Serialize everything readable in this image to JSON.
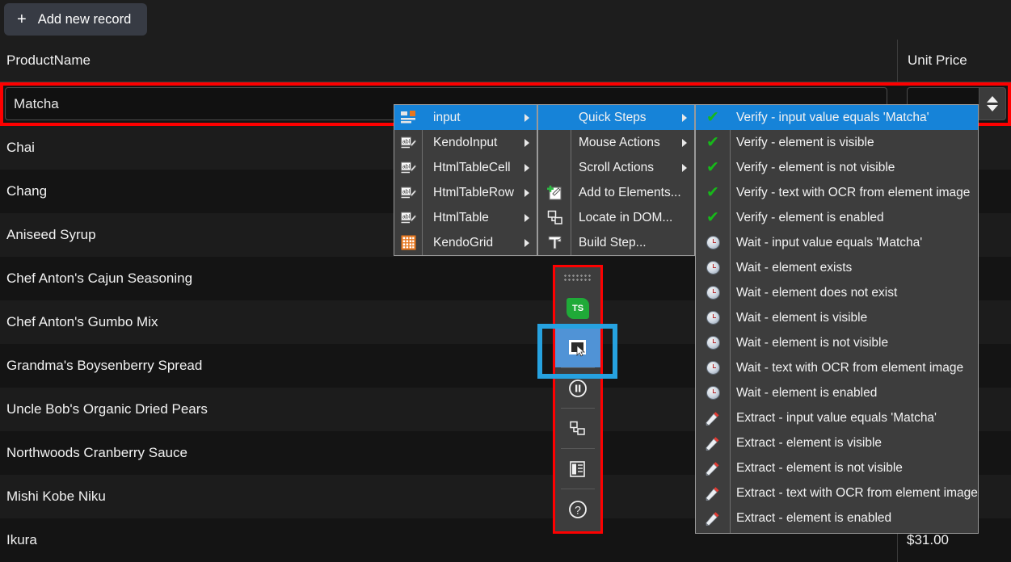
{
  "toolbar": {
    "add_record_label": "Add new record",
    "plus_glyph": "+"
  },
  "grid": {
    "columns": [
      "ProductName",
      "Unit Price"
    ],
    "edit_row": {
      "product_name_value": "Matcha",
      "unit_price_value": ""
    },
    "rows": [
      {
        "name": "Chai",
        "price": ""
      },
      {
        "name": "Chang",
        "price": ""
      },
      {
        "name": "Aniseed Syrup",
        "price": ""
      },
      {
        "name": "Chef Anton's Cajun Seasoning",
        "price": ""
      },
      {
        "name": "Chef Anton's Gumbo Mix",
        "price": ""
      },
      {
        "name": "Grandma's Boysenberry Spread",
        "price": ""
      },
      {
        "name": "Uncle Bob's Organic Dried Pears",
        "price": ""
      },
      {
        "name": "Northwoods Cranberry Sauce",
        "price": ""
      },
      {
        "name": "Mishi Kobe Niku",
        "price": ""
      },
      {
        "name": "Ikura",
        "price": "$31.00"
      }
    ]
  },
  "float_toolbar": {
    "items": [
      {
        "name": "telerik-testing-badge",
        "label": "TS"
      },
      {
        "name": "element-highlight-tool",
        "label": ""
      },
      {
        "name": "pause-recording",
        "label": ""
      },
      {
        "name": "dom-explorer",
        "label": ""
      },
      {
        "name": "page-details",
        "label": ""
      },
      {
        "name": "help",
        "label": ""
      }
    ]
  },
  "menu1": {
    "items": [
      {
        "label": "input",
        "icon": "input-element-icon",
        "has_submenu": true,
        "selected": true
      },
      {
        "label": "KendoInput",
        "icon": "kendo-input-icon",
        "has_submenu": true,
        "selected": false
      },
      {
        "label": "HtmlTableCell",
        "icon": "html-label-icon",
        "has_submenu": true,
        "selected": false
      },
      {
        "label": "HtmlTableRow",
        "icon": "html-label-icon",
        "has_submenu": true,
        "selected": false
      },
      {
        "label": "HtmlTable",
        "icon": "html-label-icon",
        "has_submenu": true,
        "selected": false
      },
      {
        "label": "KendoGrid",
        "icon": "kendo-grid-icon",
        "has_submenu": true,
        "selected": false
      }
    ]
  },
  "menu2": {
    "items": [
      {
        "label": "Quick Steps",
        "icon": "",
        "has_submenu": true,
        "selected": true
      },
      {
        "label": "Mouse Actions",
        "icon": "",
        "has_submenu": true,
        "selected": false
      },
      {
        "label": "Scroll Actions",
        "icon": "",
        "has_submenu": true,
        "selected": false
      },
      {
        "label": "Add to Elements...",
        "icon": "add-element-icon",
        "has_submenu": false,
        "selected": false
      },
      {
        "label": "Locate in DOM...",
        "icon": "locate-dom-icon",
        "has_submenu": false,
        "selected": false
      },
      {
        "label": "Build Step...",
        "icon": "build-step-icon",
        "has_submenu": false,
        "selected": false
      }
    ]
  },
  "menu3": {
    "items": [
      {
        "label": "Verify - input value equals 'Matcha'",
        "icon": "check-icon",
        "selected": true
      },
      {
        "label": "Verify - element is visible",
        "icon": "check-icon",
        "selected": false
      },
      {
        "label": "Verify - element is not visible",
        "icon": "check-icon",
        "selected": false
      },
      {
        "label": "Verify - text with OCR from element image",
        "icon": "check-icon",
        "selected": false
      },
      {
        "label": "Verify - element is enabled",
        "icon": "check-icon",
        "selected": false
      },
      {
        "label": "Wait - input value equals 'Matcha'",
        "icon": "clock-icon",
        "selected": false
      },
      {
        "label": "Wait - element exists",
        "icon": "clock-icon",
        "selected": false
      },
      {
        "label": "Wait - element does not exist",
        "icon": "clock-icon",
        "selected": false
      },
      {
        "label": "Wait - element is visible",
        "icon": "clock-icon",
        "selected": false
      },
      {
        "label": "Wait - element is not visible",
        "icon": "clock-icon",
        "selected": false
      },
      {
        "label": "Wait - text with OCR from element image",
        "icon": "clock-icon",
        "selected": false
      },
      {
        "label": "Wait - element is enabled",
        "icon": "clock-icon",
        "selected": false
      },
      {
        "label": "Extract - input value equals 'Matcha'",
        "icon": "pipette-icon",
        "selected": false
      },
      {
        "label": "Extract - element is visible",
        "icon": "pipette-icon",
        "selected": false
      },
      {
        "label": "Extract - element is not visible",
        "icon": "pipette-icon",
        "selected": false
      },
      {
        "label": "Extract - text with OCR from element image",
        "icon": "pipette-icon",
        "selected": false
      },
      {
        "label": "Extract - element is enabled",
        "icon": "pipette-icon",
        "selected": false
      }
    ]
  },
  "colors": {
    "menu_selected": "#1683d8",
    "highlight_red": "#fe0000",
    "highlight_blue": "#26a2e0",
    "check_green": "#17b81a",
    "accent_orange": "#e8761c"
  }
}
